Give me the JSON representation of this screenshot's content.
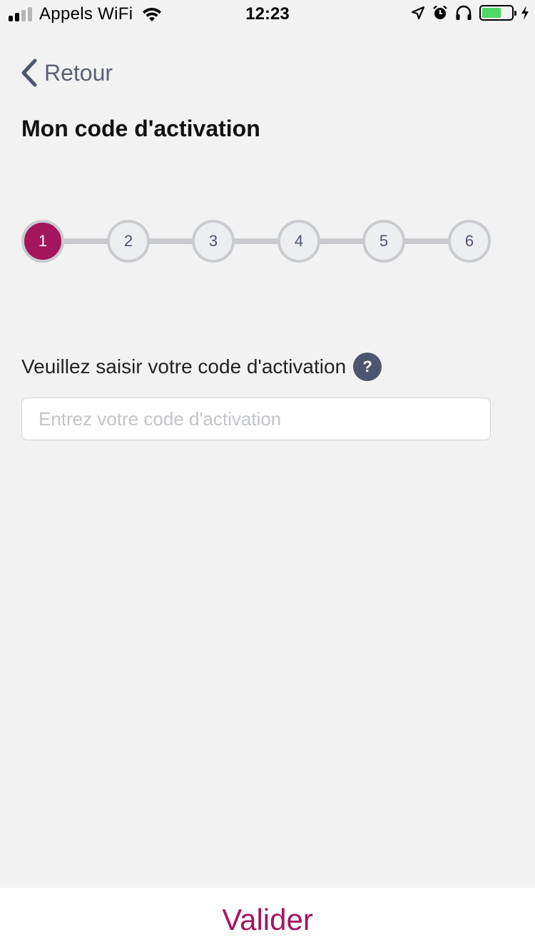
{
  "status_bar": {
    "carrier": "Appels WiFi",
    "time": "12:23",
    "signal_bars": 4,
    "signal_filled": 2,
    "battery_level": 0.66,
    "icons": [
      "wifi-icon",
      "location-icon",
      "alarm-icon",
      "headphones-icon",
      "battery-icon",
      "charging-icon"
    ]
  },
  "nav": {
    "back_label": "Retour",
    "icon": "chevron-left-icon"
  },
  "page": {
    "title": "Mon code d'activation"
  },
  "stepper": {
    "active_step": 1,
    "steps": [
      "1",
      "2",
      "3",
      "4",
      "5",
      "6"
    ]
  },
  "form": {
    "prompt": "Veuillez saisir votre code d'activation",
    "help_label": "?",
    "input_placeholder": "Entrez votre code d'activation",
    "input_value": ""
  },
  "footer": {
    "submit_label": "Valider"
  },
  "colors": {
    "accent": "#a3155d",
    "background": "#f2f2f2",
    "muted": "#4d5570"
  }
}
